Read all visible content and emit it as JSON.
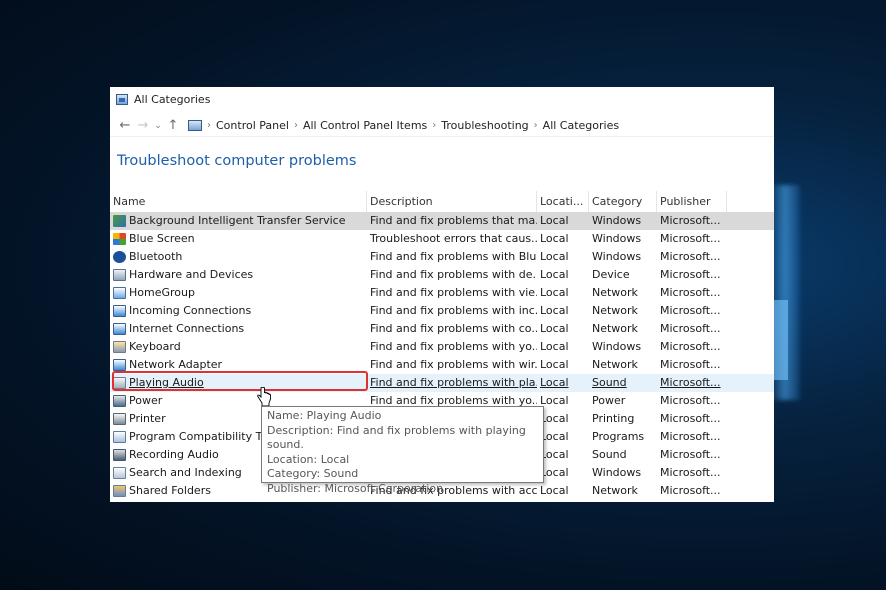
{
  "window": {
    "title": "All Categories"
  },
  "address_bar": {
    "crumbs": [
      "Control Panel",
      "All Control Panel Items",
      "Troubleshooting",
      "All Categories"
    ]
  },
  "page": {
    "heading": "Troubleshoot computer problems"
  },
  "table": {
    "headers": {
      "name": "Name",
      "description": "Description",
      "location": "Locati...",
      "category": "Category",
      "publisher": "Publisher"
    },
    "rows": [
      {
        "icon": "bits-icon",
        "name": "Background Intelligent Transfer Service",
        "description": "Find and fix problems that ma...",
        "location": "Local",
        "category": "Windows",
        "publisher": "Microsoft..."
      },
      {
        "icon": "blue-screen-icon",
        "name": "Blue Screen",
        "description": "Troubleshoot errors that caus...",
        "location": "Local",
        "category": "Windows",
        "publisher": "Microsoft..."
      },
      {
        "icon": "bluetooth-icon",
        "name": "Bluetooth",
        "description": "Find and fix problems with Blu...",
        "location": "Local",
        "category": "Windows",
        "publisher": "Microsoft..."
      },
      {
        "icon": "hardware-icon",
        "name": "Hardware and Devices",
        "description": "Find and fix problems with de...",
        "location": "Local",
        "category": "Device",
        "publisher": "Microsoft..."
      },
      {
        "icon": "homegroup-icon",
        "name": "HomeGroup",
        "description": "Find and fix problems with vie...",
        "location": "Local",
        "category": "Network",
        "publisher": "Microsoft..."
      },
      {
        "icon": "network-icon",
        "name": "Incoming Connections",
        "description": "Find and fix problems with inc...",
        "location": "Local",
        "category": "Network",
        "publisher": "Microsoft..."
      },
      {
        "icon": "network-icon",
        "name": "Internet Connections",
        "description": "Find and fix problems with co...",
        "location": "Local",
        "category": "Network",
        "publisher": "Microsoft..."
      },
      {
        "icon": "keyboard-icon",
        "name": "Keyboard",
        "description": "Find and fix problems with yo...",
        "location": "Local",
        "category": "Windows",
        "publisher": "Microsoft..."
      },
      {
        "icon": "network-icon",
        "name": "Network Adapter",
        "description": "Find and fix problems with wir...",
        "location": "Local",
        "category": "Network",
        "publisher": "Microsoft..."
      },
      {
        "icon": "speaker-icon",
        "name": "Playing Audio",
        "description": "Find and fix problems with pla...",
        "location": "Local",
        "category": "Sound",
        "publisher": "Microsoft..."
      },
      {
        "icon": "power-icon",
        "name": "Power",
        "description": "Find and fix problems with yo...",
        "location": "Local",
        "category": "Power",
        "publisher": "Microsoft..."
      },
      {
        "icon": "printer-icon",
        "name": "Printer",
        "description": "",
        "location": "Local",
        "category": "Printing",
        "publisher": "Microsoft..."
      },
      {
        "icon": "program-compat-icon",
        "name": "Program Compatibility Tro",
        "description": "",
        "location": "Local",
        "category": "Programs",
        "publisher": "Microsoft..."
      },
      {
        "icon": "recording-icon",
        "name": "Recording Audio",
        "description": "",
        "location": "Local",
        "category": "Sound",
        "publisher": "Microsoft..."
      },
      {
        "icon": "search-index-icon",
        "name": "Search and Indexing",
        "description": "",
        "location": "Local",
        "category": "Windows",
        "publisher": "Microsoft..."
      },
      {
        "icon": "shared-folders-icon",
        "name": "Shared Folders",
        "description": "Find and fix problems with acc...",
        "location": "Local",
        "category": "Network",
        "publisher": "Microsoft..."
      }
    ]
  },
  "tooltip": {
    "name": "Name: Playing Audio",
    "description": "Description: Find and fix problems with playing sound.",
    "location": "Location: Local",
    "category": "Category: Sound",
    "publisher": "Publisher: Microsoft Corporation"
  },
  "colors": {
    "heading": "#1e5fa8",
    "highlight_border": "#e03131",
    "selected_row": "#d9d9d9",
    "hover_row": "#e5f1fb"
  }
}
